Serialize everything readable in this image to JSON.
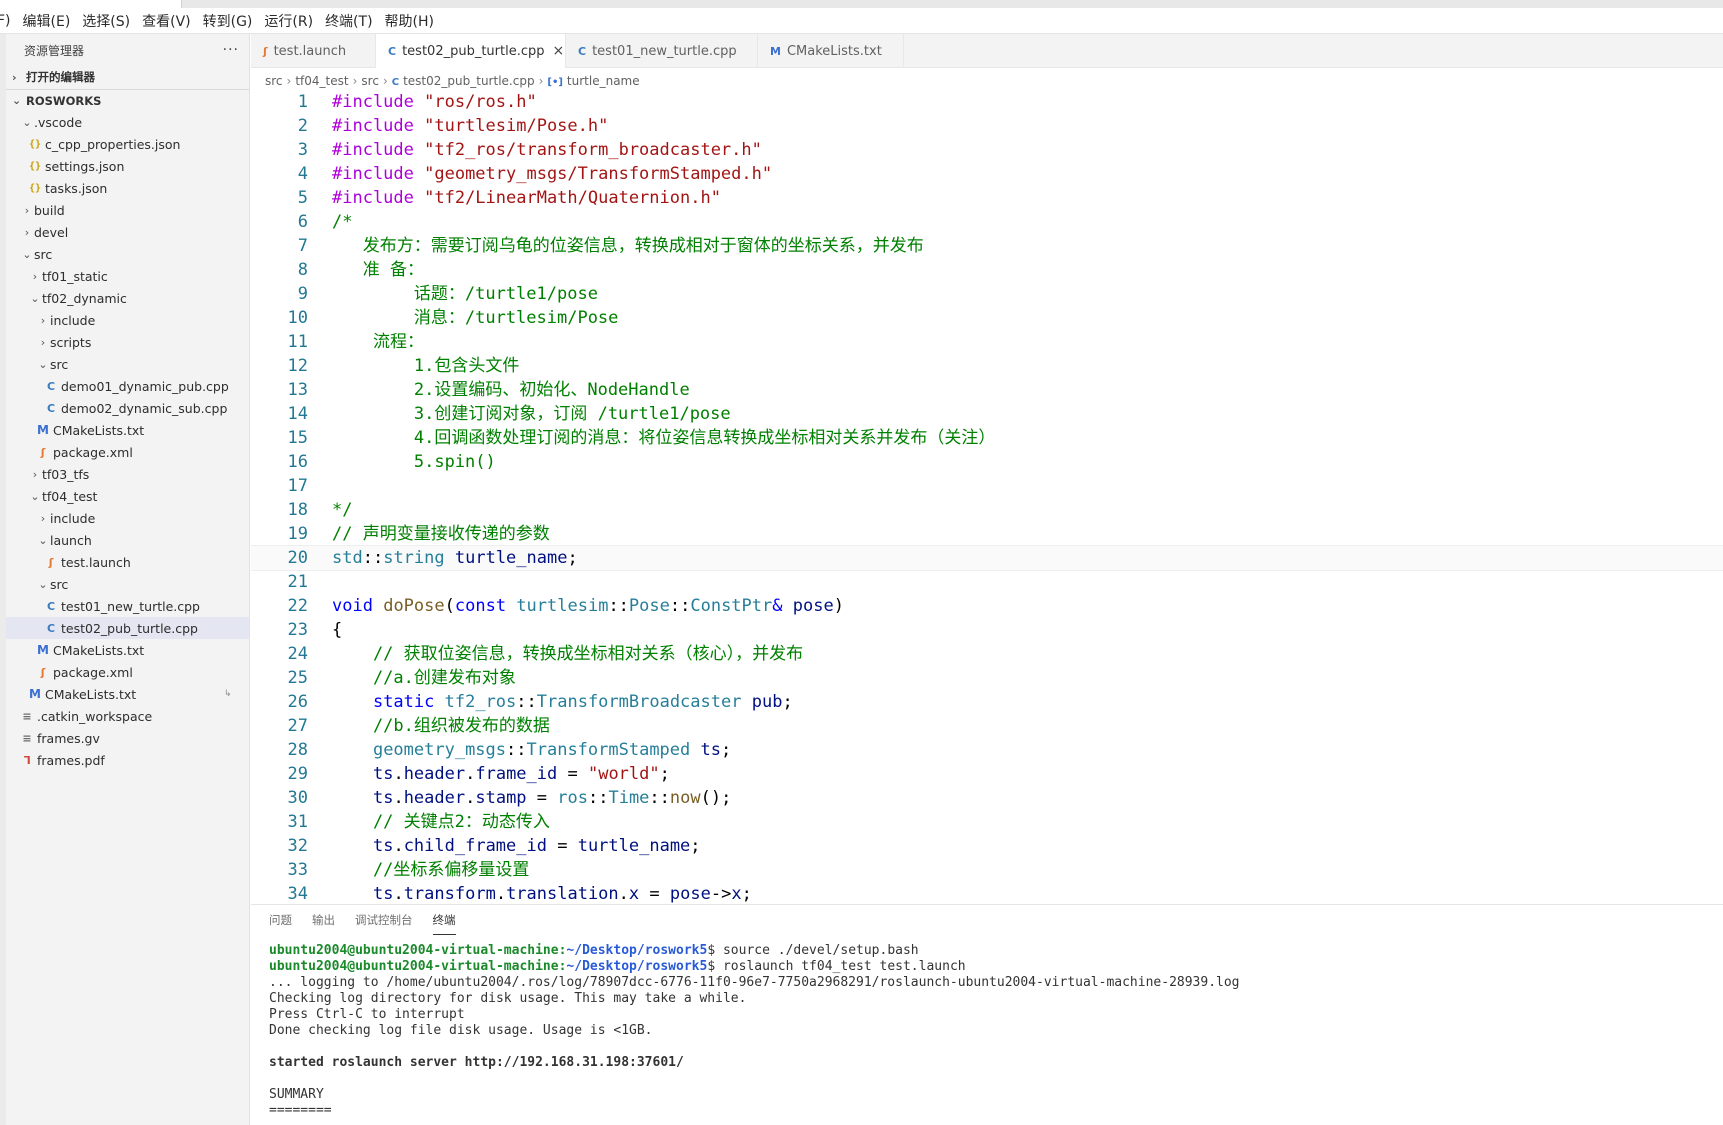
{
  "menubar": {
    "items": [
      "F)",
      "编辑(E)",
      "选择(S)",
      "查看(V)",
      "转到(G)",
      "运行(R)",
      "终端(T)",
      "帮助(H)"
    ]
  },
  "sidebar": {
    "title": "资源管理器",
    "more": "···",
    "open_editors": "打开的编辑器",
    "workspace": "ROSWORKS",
    "items": [
      {
        "label": ".vscode",
        "depth": 1,
        "kind": "folder-open"
      },
      {
        "label": "c_cpp_properties.json",
        "depth": 2,
        "kind": "json"
      },
      {
        "label": "settings.json",
        "depth": 2,
        "kind": "json"
      },
      {
        "label": "tasks.json",
        "depth": 2,
        "kind": "json"
      },
      {
        "label": "build",
        "depth": 1,
        "kind": "folder"
      },
      {
        "label": "devel",
        "depth": 1,
        "kind": "folder"
      },
      {
        "label": "src",
        "depth": 1,
        "kind": "folder-open"
      },
      {
        "label": "tf01_static",
        "depth": 2,
        "kind": "folder"
      },
      {
        "label": "tf02_dynamic",
        "depth": 2,
        "kind": "folder-open"
      },
      {
        "label": "include",
        "depth": 3,
        "kind": "folder"
      },
      {
        "label": "scripts",
        "depth": 3,
        "kind": "folder"
      },
      {
        "label": "src",
        "depth": 3,
        "kind": "folder-open"
      },
      {
        "label": "demo01_dynamic_pub.cpp",
        "depth": 4,
        "kind": "cpp"
      },
      {
        "label": "demo02_dynamic_sub.cpp",
        "depth": 4,
        "kind": "cpp"
      },
      {
        "label": "CMakeLists.txt",
        "depth": 3,
        "kind": "cmake"
      },
      {
        "label": "package.xml",
        "depth": 3,
        "kind": "xml"
      },
      {
        "label": "tf03_tfs",
        "depth": 2,
        "kind": "folder"
      },
      {
        "label": "tf04_test",
        "depth": 2,
        "kind": "folder-open"
      },
      {
        "label": "include",
        "depth": 3,
        "kind": "folder"
      },
      {
        "label": "launch",
        "depth": 3,
        "kind": "folder-open"
      },
      {
        "label": "test.launch",
        "depth": 4,
        "kind": "xml"
      },
      {
        "label": "src",
        "depth": 3,
        "kind": "folder-open"
      },
      {
        "label": "test01_new_turtle.cpp",
        "depth": 4,
        "kind": "cpp"
      },
      {
        "label": "test02_pub_turtle.cpp",
        "depth": 4,
        "kind": "cpp",
        "selected": true
      },
      {
        "label": "CMakeLists.txt",
        "depth": 3,
        "kind": "cmake"
      },
      {
        "label": "package.xml",
        "depth": 3,
        "kind": "xml"
      },
      {
        "label": "CMakeLists.txt",
        "depth": 2,
        "kind": "cmake",
        "badge": "↳"
      },
      {
        "label": ".catkin_workspace",
        "depth": 1,
        "kind": "text"
      },
      {
        "label": "frames.gv",
        "depth": 1,
        "kind": "text"
      },
      {
        "label": "frames.pdf",
        "depth": 1,
        "kind": "pdf"
      }
    ]
  },
  "tabs": [
    {
      "label": "test.launch",
      "icon": "xml-file-icon"
    },
    {
      "label": "test02_pub_turtle.cpp",
      "icon": "cpp-file-icon",
      "active": true,
      "close": "×"
    },
    {
      "label": "test01_new_turtle.cpp",
      "icon": "cpp-file-icon"
    },
    {
      "label": "CMakeLists.txt",
      "icon": "cmake-file-icon"
    }
  ],
  "breadcrumb": [
    "src",
    "tf04_test",
    "src",
    "test02_pub_turtle.cpp",
    "turtle_name"
  ],
  "code": {
    "current_line": 20,
    "lines": [
      [
        [
          "pp",
          "#include "
        ],
        [
          "str",
          "\"ros/ros.h\""
        ]
      ],
      [
        [
          "pp",
          "#include "
        ],
        [
          "str",
          "\"turtlesim/Pose.h\""
        ]
      ],
      [
        [
          "pp",
          "#include "
        ],
        [
          "str",
          "\"tf2_ros/transform_broadcaster.h\""
        ]
      ],
      [
        [
          "pp",
          "#include "
        ],
        [
          "str",
          "\"geometry_msgs/TransformStamped.h\""
        ]
      ],
      [
        [
          "pp",
          "#include "
        ],
        [
          "str",
          "\"tf2/LinearMath/Quaternion.h\""
        ]
      ],
      [
        [
          "com",
          "/*"
        ]
      ],
      [
        [
          "com",
          "   发布方：需要订阅乌龟的位姿信息，转换成相对于窗体的坐标关系，并发布"
        ]
      ],
      [
        [
          "com",
          "   准 备："
        ]
      ],
      [
        [
          "com",
          "        话题：/turtle1/pose"
        ]
      ],
      [
        [
          "com",
          "        消息：/turtlesim/Pose"
        ]
      ],
      [
        [
          "com",
          "    流程："
        ]
      ],
      [
        [
          "com",
          "        1.包含头文件"
        ]
      ],
      [
        [
          "com",
          "        2.设置编码、初始化、NodeHandle"
        ]
      ],
      [
        [
          "com",
          "        3.创建订阅对象，订阅 /turtle1/pose"
        ]
      ],
      [
        [
          "com",
          "        4.回调函数处理订阅的消息：将位姿信息转换成坐标相对关系并发布（关注）"
        ]
      ],
      [
        [
          "com",
          "        5.spin()"
        ]
      ],
      [
        [
          "plain",
          ""
        ]
      ],
      [
        [
          "com",
          "*/"
        ]
      ],
      [
        [
          "com",
          "// 声明变量接收传递的参数"
        ]
      ],
      [
        [
          "type",
          "std"
        ],
        [
          "plain",
          "::"
        ],
        [
          "type",
          "string"
        ],
        [
          "plain",
          " "
        ],
        [
          "var",
          "turtle_name"
        ],
        [
          "plain",
          ";"
        ]
      ],
      [
        [
          "plain",
          ""
        ]
      ],
      [
        [
          "kw",
          "void"
        ],
        [
          "plain",
          " "
        ],
        [
          "fn",
          "doPose"
        ],
        [
          "plain",
          "("
        ],
        [
          "kw",
          "const"
        ],
        [
          "plain",
          " "
        ],
        [
          "type",
          "turtlesim"
        ],
        [
          "plain",
          "::"
        ],
        [
          "type",
          "Pose"
        ],
        [
          "plain",
          "::"
        ],
        [
          "type",
          "ConstPtr"
        ],
        [
          "kw",
          "&"
        ],
        [
          "plain",
          " "
        ],
        [
          "var",
          "pose"
        ],
        [
          "plain",
          ")"
        ]
      ],
      [
        [
          "plain",
          "{"
        ]
      ],
      [
        [
          "com",
          "    // 获取位姿信息，转换成坐标相对关系（核心），并发布"
        ]
      ],
      [
        [
          "com",
          "    //a.创建发布对象"
        ]
      ],
      [
        [
          "plain",
          "    "
        ],
        [
          "kw",
          "static"
        ],
        [
          "plain",
          " "
        ],
        [
          "type",
          "tf2_ros"
        ],
        [
          "plain",
          "::"
        ],
        [
          "type",
          "TransformBroadcaster"
        ],
        [
          "plain",
          " "
        ],
        [
          "var",
          "pub"
        ],
        [
          "plain",
          ";"
        ]
      ],
      [
        [
          "com",
          "    //b.组织被发布的数据"
        ]
      ],
      [
        [
          "plain",
          "    "
        ],
        [
          "type",
          "geometry_msgs"
        ],
        [
          "plain",
          "::"
        ],
        [
          "type",
          "TransformStamped"
        ],
        [
          "plain",
          " "
        ],
        [
          "var",
          "ts"
        ],
        [
          "plain",
          ";"
        ]
      ],
      [
        [
          "plain",
          "    "
        ],
        [
          "var",
          "ts"
        ],
        [
          "plain",
          "."
        ],
        [
          "var",
          "header"
        ],
        [
          "plain",
          "."
        ],
        [
          "var",
          "frame_id"
        ],
        [
          "plain",
          " = "
        ],
        [
          "str",
          "\"world\""
        ],
        [
          "plain",
          ";"
        ]
      ],
      [
        [
          "plain",
          "    "
        ],
        [
          "var",
          "ts"
        ],
        [
          "plain",
          "."
        ],
        [
          "var",
          "header"
        ],
        [
          "plain",
          "."
        ],
        [
          "var",
          "stamp"
        ],
        [
          "plain",
          " = "
        ],
        [
          "type",
          "ros"
        ],
        [
          "plain",
          "::"
        ],
        [
          "type",
          "Time"
        ],
        [
          "plain",
          "::"
        ],
        [
          "fn",
          "now"
        ],
        [
          "plain",
          "();"
        ]
      ],
      [
        [
          "com",
          "    // 关键点2：动态传入"
        ]
      ],
      [
        [
          "plain",
          "    "
        ],
        [
          "var",
          "ts"
        ],
        [
          "plain",
          "."
        ],
        [
          "var",
          "child_frame_id"
        ],
        [
          "plain",
          " = "
        ],
        [
          "var",
          "turtle_name"
        ],
        [
          "plain",
          ";"
        ]
      ],
      [
        [
          "com",
          "    //坐标系偏移量设置"
        ]
      ],
      [
        [
          "plain",
          "    "
        ],
        [
          "var",
          "ts"
        ],
        [
          "plain",
          "."
        ],
        [
          "var",
          "transform"
        ],
        [
          "plain",
          "."
        ],
        [
          "var",
          "translation"
        ],
        [
          "plain",
          "."
        ],
        [
          "var",
          "x"
        ],
        [
          "plain",
          " = "
        ],
        [
          "var",
          "pose"
        ],
        [
          "plain",
          "->"
        ],
        [
          "var",
          "x"
        ],
        [
          "plain",
          ";"
        ]
      ]
    ]
  },
  "panel": {
    "tabs": [
      "问题",
      "输出",
      "调试控制台",
      "终端"
    ],
    "active_tab": 3,
    "terminal": [
      {
        "user": "ubuntu2004@ubuntu2004-virtual-machine:",
        "path": "~/Desktop/roswork5",
        "cmd": "$ source ./devel/setup.bash"
      },
      {
        "user": "ubuntu2004@ubuntu2004-virtual-machine:",
        "path": "~/Desktop/roswork5",
        "cmd": "$ roslaunch tf04_test test.launch"
      },
      {
        "text": "... logging to /home/ubuntu2004/.ros/log/78907dcc-6776-11f0-96e7-7750a2968291/roslaunch-ubuntu2004-virtual-machine-28939.log"
      },
      {
        "text": "Checking log directory for disk usage. This may take a while."
      },
      {
        "text": "Press Ctrl-C to interrupt"
      },
      {
        "text": "Done checking log file disk usage. Usage is <1GB."
      },
      {
        "text": ""
      },
      {
        "text": "started roslaunch server http://192.168.31.198:37601/",
        "bold": true
      },
      {
        "text": ""
      },
      {
        "text": "SUMMARY"
      },
      {
        "text": "========"
      }
    ]
  }
}
